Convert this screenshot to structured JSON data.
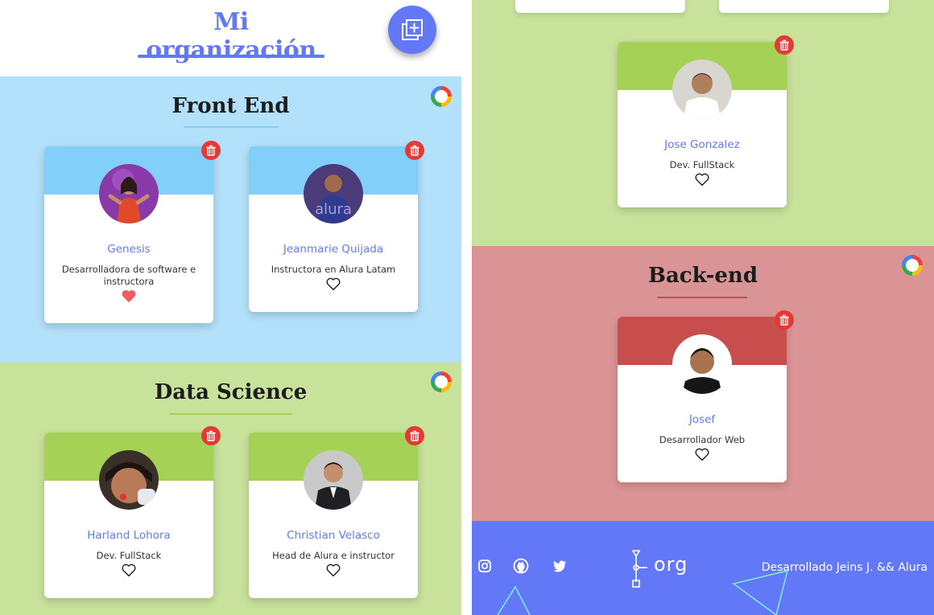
{
  "header": {
    "title": "Mi organización",
    "add_button_icon": "add-square-icon"
  },
  "colors": {
    "accent": "#6278f7",
    "frontend_bg": "#b3e0fa",
    "frontend_card": "#82cffa",
    "datascience_bg": "#c8e29c",
    "datascience_card": "#a6d157",
    "backend_bg": "#db9495",
    "backend_card": "#c84e4e",
    "delete": "#e53935",
    "liked": "#f25c64"
  },
  "teams": [
    {
      "title": "Front End",
      "members": [
        {
          "name": "Genesis",
          "role": "Desarrolladora de software e instructora",
          "liked": true
        },
        {
          "name": "Jeanmarie Quijada",
          "role": "Instructora en Alura Latam",
          "liked": false
        }
      ]
    },
    {
      "title": "Data Science",
      "members": [
        {
          "name": "Harland Lohora",
          "role": "Dev. FullStack",
          "liked": false
        },
        {
          "name": "Christian Velasco",
          "role": "Head de Alura e instructor",
          "liked": false
        },
        {
          "name": "Jose Gonzalez",
          "role": "Dev. FullStack",
          "liked": false
        }
      ]
    },
    {
      "title": "Back-end",
      "members": [
        {
          "name": "Josef",
          "role": "Desarrollador Web",
          "liked": false
        }
      ]
    }
  ],
  "footer": {
    "logo": "org",
    "credits": "Desarrollado Jeins J. && Alura",
    "social_icons": [
      "instagram-icon",
      "github-icon",
      "twitter-icon"
    ]
  }
}
